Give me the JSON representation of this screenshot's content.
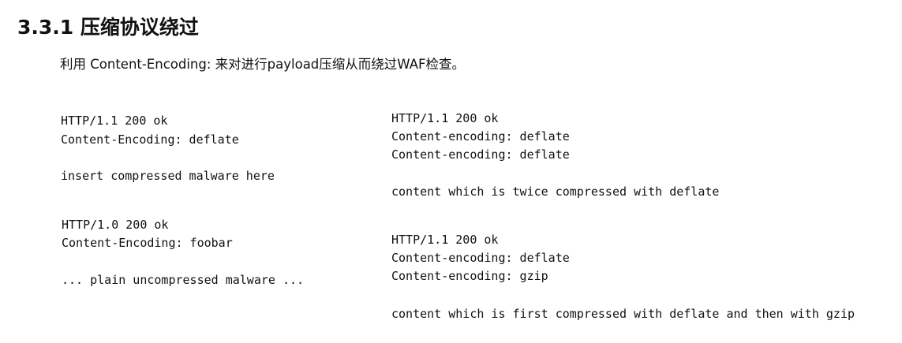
{
  "page": {
    "title": "3.3.1 压缩协议绕过",
    "intro": "利用 Content-Encoding: 来对进行payload压缩从而绕过WAF检查。"
  },
  "examples": {
    "left_1": {
      "status": "HTTP/1.1 200 ok",
      "header": "Content-Encoding: deflate",
      "body": "insert compressed malware here"
    },
    "left_2": {
      "status": "HTTP/1.0 200 ok",
      "header": "Content-Encoding: foobar",
      "body": "... plain uncompressed malware ..."
    },
    "right_1": {
      "status": "HTTP/1.1 200 ok",
      "header_1": "Content-encoding: deflate",
      "header_2": "Content-encoding: deflate",
      "body": "content which is twice compressed with deflate"
    },
    "right_2": {
      "status": "HTTP/1.1 200 ok",
      "header_1": "Content-encoding: deflate",
      "header_2": "Content-encoding: gzip",
      "body": "content which is first compressed with deflate and then with gzip"
    }
  }
}
